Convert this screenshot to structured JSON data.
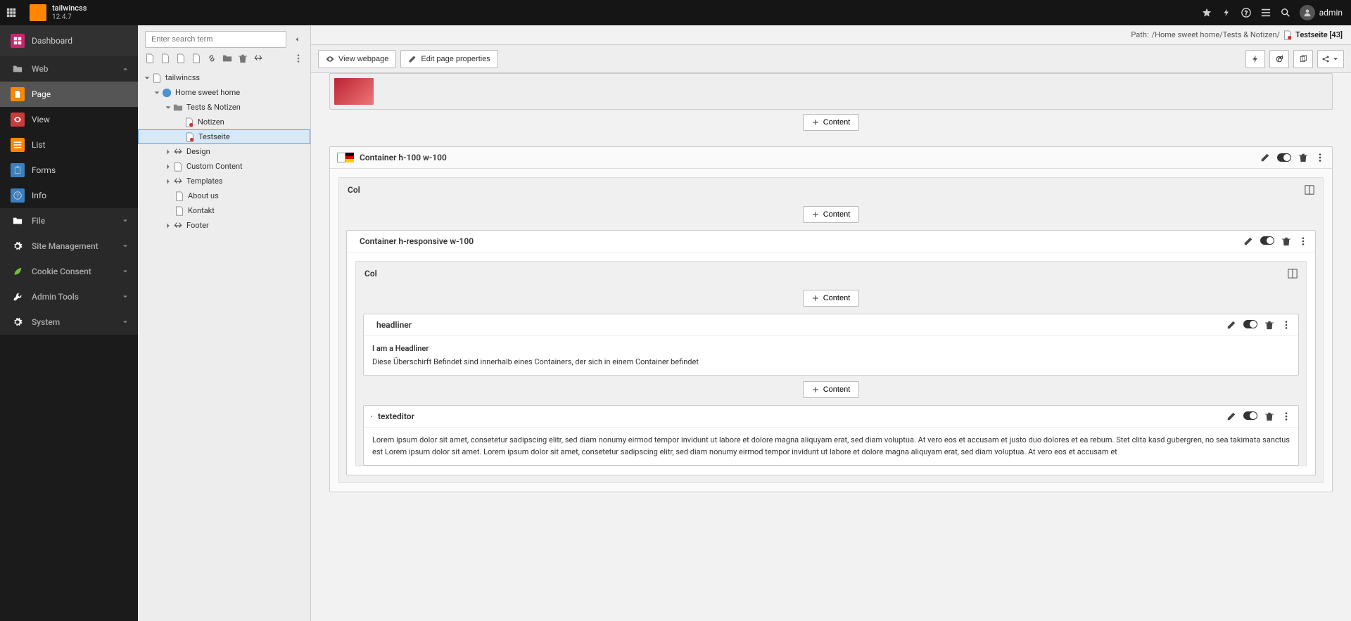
{
  "topbar": {
    "site_name": "tailwincss",
    "version": "12.4.7",
    "user": "admin"
  },
  "sidebar": {
    "dashboard": "Dashboard",
    "web": {
      "label": "Web",
      "page": "Page",
      "view": "View",
      "list": "List",
      "forms": "Forms",
      "info": "Info"
    },
    "file": "File",
    "site_mgmt": "Site Management",
    "cookie": "Cookie Consent",
    "admin": "Admin Tools",
    "system": "System"
  },
  "tree": {
    "search_ph": "Enter search term",
    "root": "tailwincss",
    "home": "Home sweet home",
    "tests": "Tests & Notizen",
    "notizen": "Notizen",
    "testseite": "Testseite",
    "design": "Design",
    "custom": "Custom Content",
    "templates": "Templates",
    "about": "About us",
    "kontakt": "Kontakt",
    "footer": "Footer"
  },
  "path": {
    "label": "Path:",
    "crumbs": "/Home sweet home/Tests & Notizen/",
    "page": "Testseite [43]"
  },
  "toolbar": {
    "view": "View webpage",
    "edit": "Edit page properties"
  },
  "content": {
    "add": "Content",
    "col": "Col",
    "c1": {
      "title": "Container h-100 w-100"
    },
    "c2": {
      "title": "Container h-responsive w-100"
    },
    "headliner": {
      "title": "headliner",
      "h": "I am a Headliner",
      "p": "Diese Überschirft Befindet sind innerhalb eines Containers, der sich in einem Container befindet"
    },
    "texteditor": {
      "title": "texteditor",
      "p": "Lorem ipsum dolor sit amet, consetetur sadipscing elitr, sed diam nonumy eirmod tempor invidunt ut labore et dolore magna aliquyam erat, sed diam voluptua. At vero eos et accusam et justo duo dolores et ea rebum. Stet clita kasd gubergren, no sea takimata sanctus est Lorem ipsum dolor sit amet. Lorem ipsum dolor sit amet, consetetur sadipscing elitr, sed diam nonumy eirmod tempor invidunt ut labore et dolore magna aliquyam erat, sed diam voluptua. At vero eos et accusam et"
    }
  }
}
